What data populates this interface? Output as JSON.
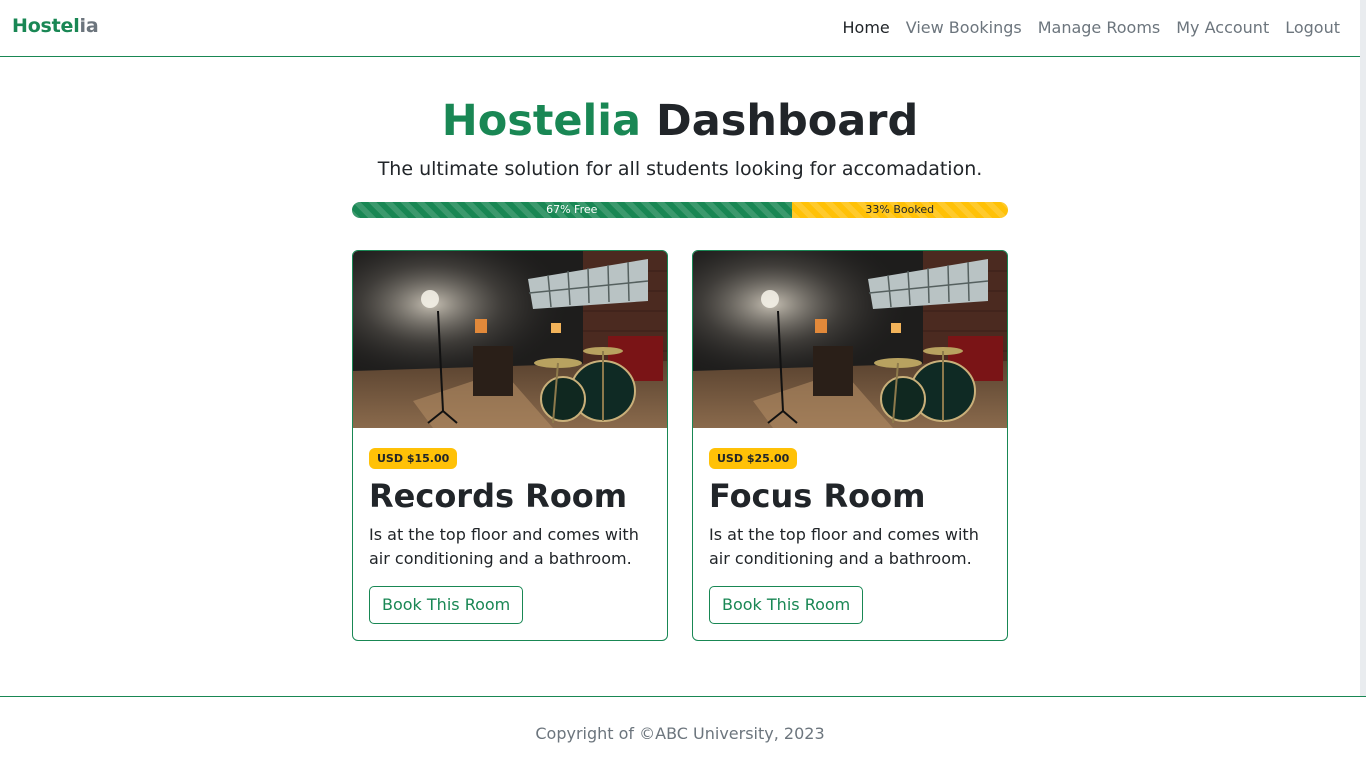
{
  "brand": {
    "part1": "Hostel",
    "part2": "ia"
  },
  "nav": {
    "items": [
      {
        "label": "Home",
        "active": true
      },
      {
        "label": "View Bookings",
        "active": false
      },
      {
        "label": "Manage Rooms",
        "active": false
      },
      {
        "label": "My Account",
        "active": false
      },
      {
        "label": "Logout",
        "active": false
      }
    ]
  },
  "hero": {
    "title_accent": "Hostelia",
    "title_rest": "Dashboard",
    "subtitle": "The ultimate solution for all students looking for accomadation."
  },
  "occupancy": {
    "free_label": "67% Free",
    "free_percent": 67,
    "booked_label": "33% Booked",
    "booked_percent": 33
  },
  "rooms": [
    {
      "price": "USD $15.00",
      "name": "Records Room",
      "description": "Is at the top floor and comes with air conditioning and a bathroom.",
      "button_label": "Book This Room",
      "image": "music-studio-photo"
    },
    {
      "price": "USD $25.00",
      "name": "Focus Room",
      "description": "Is at the top floor and comes with air conditioning and a bathroom.",
      "button_label": "Book This Room",
      "image": "music-studio-photo"
    }
  ],
  "footer": {
    "text": "Copyright of ©ABC University, 2023"
  },
  "colors": {
    "primary": "#198754",
    "warning": "#ffc107",
    "muted": "#6c757d",
    "text": "#212529"
  }
}
